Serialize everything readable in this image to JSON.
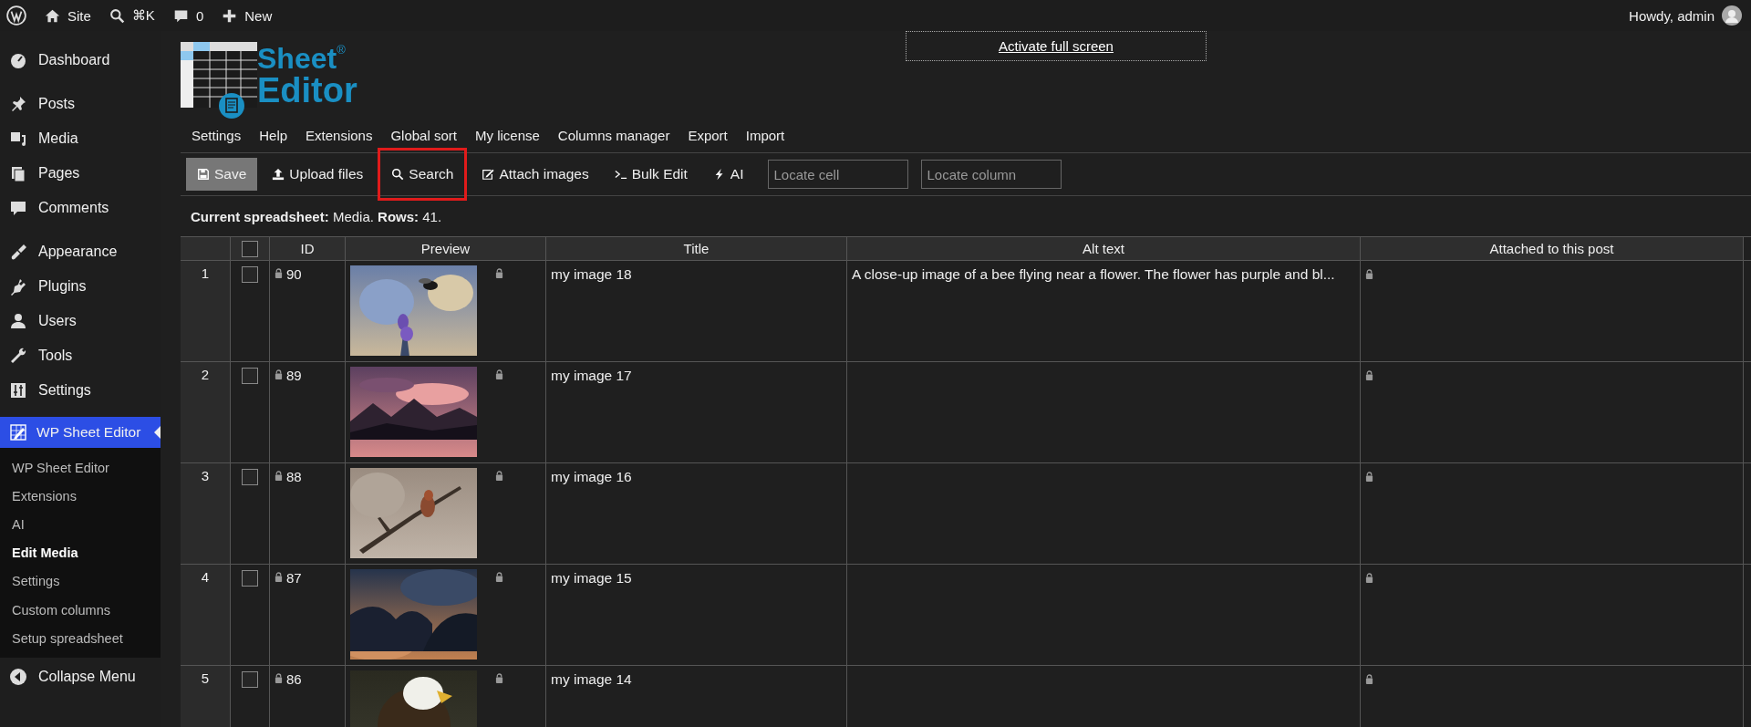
{
  "admin_bar": {
    "site": "Site",
    "shortcut": "⌘K",
    "comments": "0",
    "new": "New",
    "greeting": "Howdy, admin"
  },
  "sidebar": {
    "groups": [
      {
        "items": [
          {
            "label": "Dashboard",
            "selected": false
          }
        ]
      },
      {
        "items": [
          {
            "label": "Posts",
            "selected": false
          },
          {
            "label": "Media",
            "selected": false
          },
          {
            "label": "Pages",
            "selected": false
          },
          {
            "label": "Comments",
            "selected": false
          }
        ]
      },
      {
        "items": [
          {
            "label": "Appearance",
            "selected": false
          },
          {
            "label": "Plugins",
            "selected": false
          },
          {
            "label": "Users",
            "selected": false
          },
          {
            "label": "Tools",
            "selected": false
          },
          {
            "label": "Settings",
            "selected": false
          }
        ]
      },
      {
        "items": [
          {
            "label": "WP Sheet Editor",
            "selected": true
          }
        ]
      }
    ],
    "submenu": [
      {
        "label": "WP Sheet Editor",
        "selected": false
      },
      {
        "label": "Extensions",
        "selected": false
      },
      {
        "label": "AI",
        "selected": false
      },
      {
        "label": "Edit Media",
        "selected": true
      },
      {
        "label": "Settings",
        "selected": false
      },
      {
        "label": "Custom columns",
        "selected": false
      },
      {
        "label": "Setup spreadsheet",
        "selected": false
      }
    ],
    "collapse": "Collapse Menu"
  },
  "logo": {
    "line_1": "Sheet$^{®}$",
    "line_2": "Editor"
  },
  "fullscreen_button": "Activate full screen",
  "menu": [
    "Settings",
    "Help",
    "Extensions",
    "Global sort",
    "My license",
    "Columns manager",
    "Export",
    "Import"
  ],
  "toolbar": {
    "buttons": [
      {
        "label": "Save",
        "kind": "save",
        "highlighted": false
      },
      {
        "label": "Upload files",
        "kind": "upload",
        "highlighted": false
      },
      {
        "label": "Search",
        "kind": "search",
        "highlighted": true
      },
      {
        "label": "Attach images",
        "kind": "attach",
        "highlighted": false
      },
      {
        "label": "Bulk Edit",
        "kind": "bulk",
        "highlighted": false
      },
      {
        "label": "AI",
        "kind": "ai",
        "highlighted": false
      }
    ],
    "fields": [
      {
        "placeholder": "Locate cell"
      },
      {
        "placeholder": "Locate column"
      }
    ]
  },
  "info": "**Current spreadsheet:** Media. **Rows:** 41.",
  "table": {
    "select_all": {
      "checked": false
    },
    "columns": [
      "ID",
      "Preview",
      "Title",
      "Alt text",
      "Attached to this post"
    ],
    "rows": [
      {
        "number": "1",
        "checked": false,
        "id": "90",
        "locked": true,
        "title": "my image 18",
        "alt_text": "A close-up image of a bee flying near a flower. The flower has purple and bl..."
      },
      {
        "number": "2",
        "checked": false,
        "id": "89",
        "locked": true,
        "title": "my image 17"
      },
      {
        "number": "3",
        "checked": false,
        "id": "88",
        "locked": true,
        "title": "my image 16"
      },
      {
        "number": "4",
        "checked": false,
        "id": "87",
        "locked": true,
        "title": "my image 15"
      },
      {
        "number": "5",
        "checked": false,
        "id": "86",
        "locked": true,
        "title": "my image 14"
      }
    ]
  }
}
